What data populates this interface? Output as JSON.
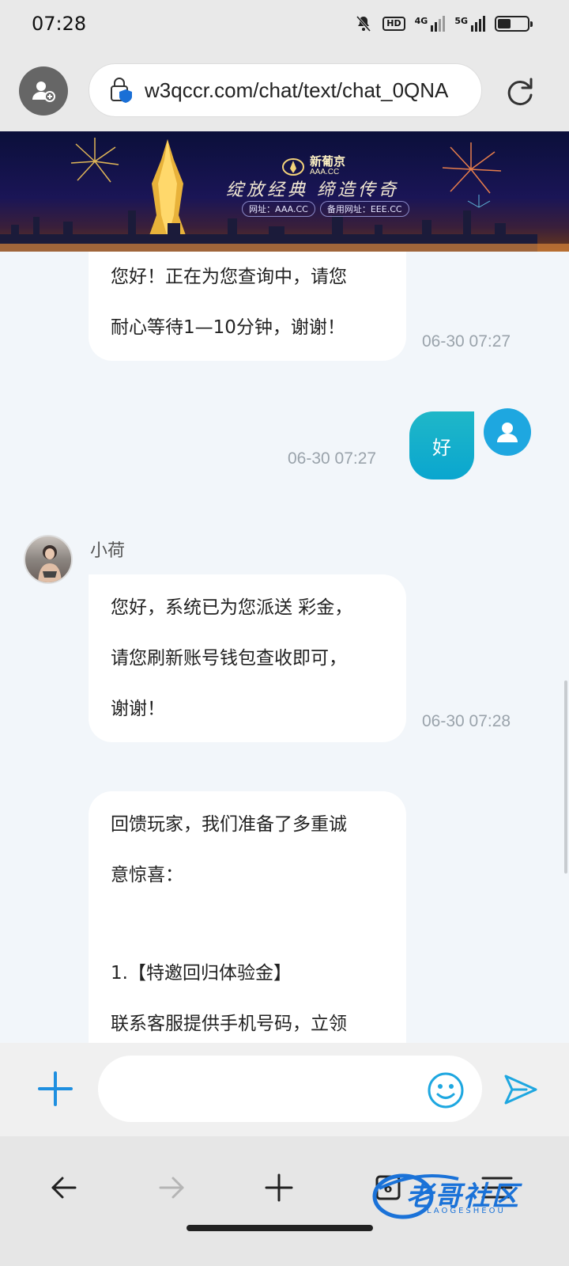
{
  "status_bar": {
    "time": "07:28",
    "hd_label": "HD",
    "net1": "4G",
    "net2": "5G"
  },
  "browser": {
    "url": "w3qccr.com/chat/text/chat_0QNA"
  },
  "banner": {
    "brand_name": "新葡京",
    "brand_sub": "AAA.CC",
    "slogan": "绽放经典 缔造传奇",
    "url_primary": "网址：AAA.CC",
    "url_backup": "备用网址：EEE.CC"
  },
  "chat": {
    "agent_name": "小荷",
    "messages": [
      {
        "from": "agent",
        "lines": [
          "您好！正在为您查询中，请您",
          "耐心等待1—10分钟，谢谢！"
        ],
        "time": "06-30 07:27"
      },
      {
        "from": "user",
        "lines": [
          "好"
        ],
        "time": "06-30 07:27"
      },
      {
        "from": "agent",
        "lines": [
          "您好，系统已为您派送 彩金，",
          "请您刷新账号钱包查收即可，",
          "谢谢！"
        ],
        "time": "06-30 07:28"
      },
      {
        "from": "agent",
        "lines": [
          "回馈玩家，我们准备了多重诚",
          "意惊喜：",
          "",
          "1.【特邀回归体验金】",
          "联系客服提供手机号码，立领"
        ],
        "time": ""
      }
    ]
  },
  "input": {
    "placeholder": ""
  },
  "nav": {
    "tab_count": "6"
  },
  "watermark": {
    "text": "老哥社区",
    "sub": "LAOGESHEOU"
  },
  "colors": {
    "accent": "#1ea7e0",
    "user_bubble": "#0aa6cf",
    "chat_bg": "#f2f6fa"
  }
}
